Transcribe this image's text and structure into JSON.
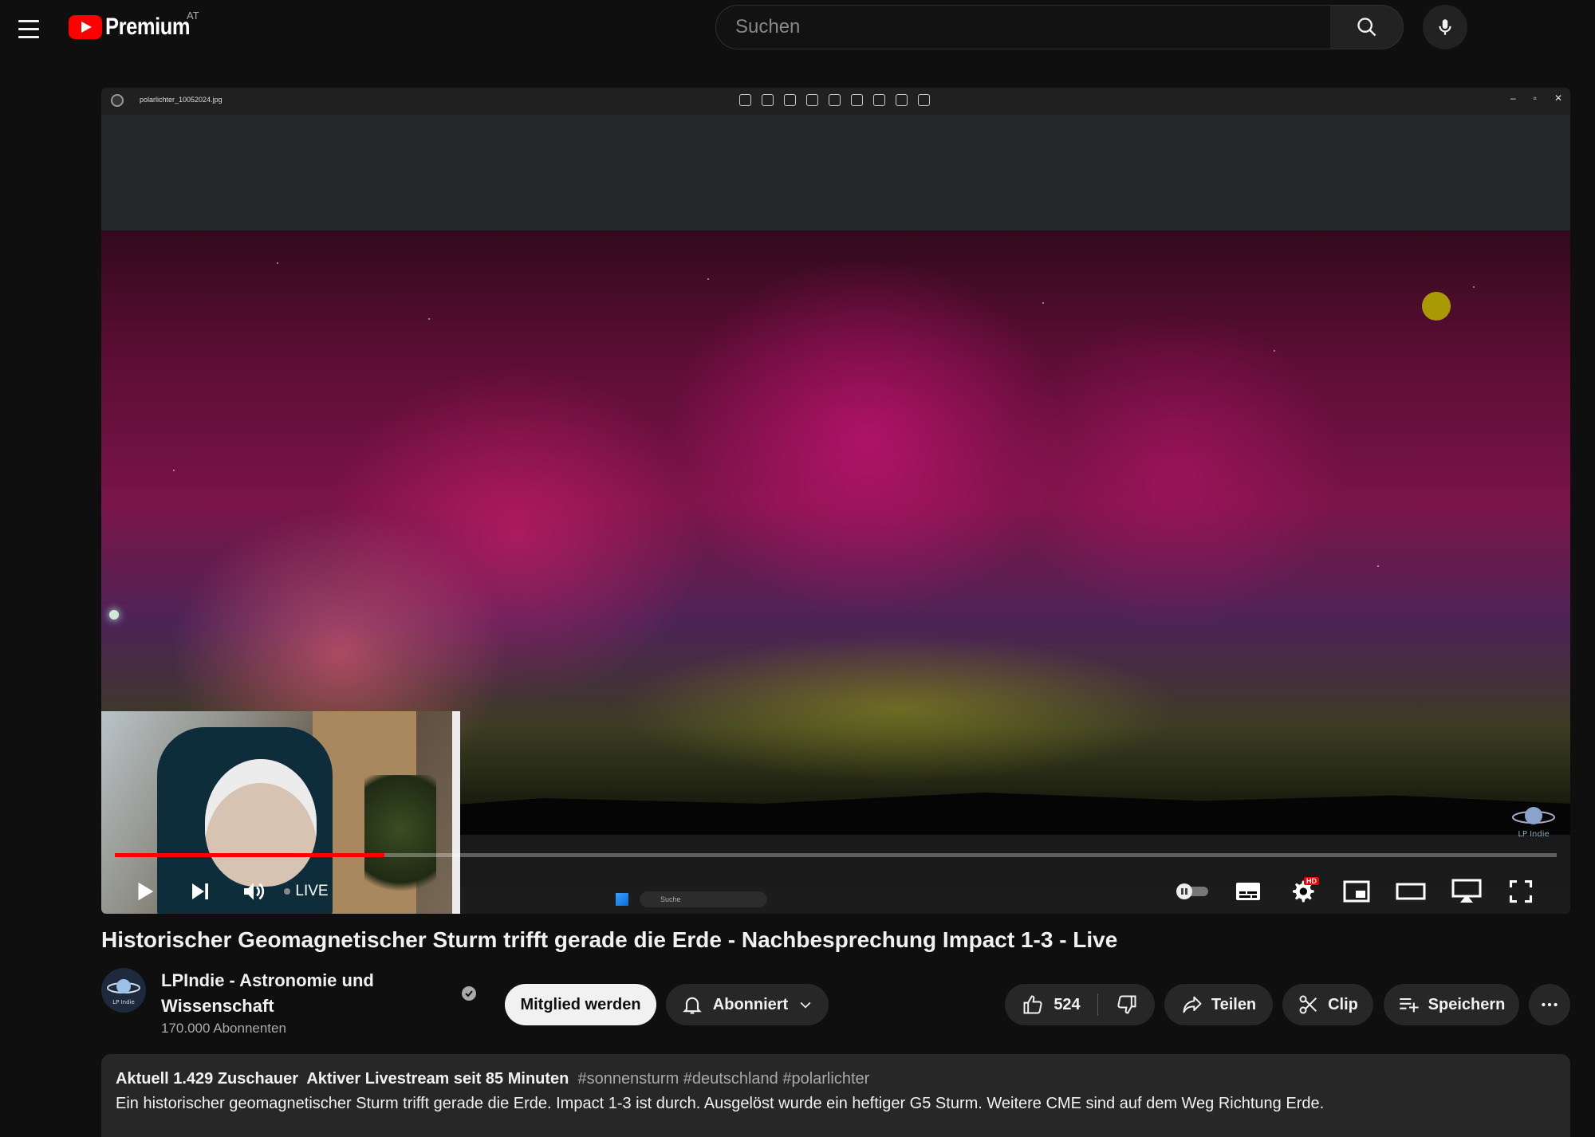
{
  "masthead": {
    "logo_text": "Premium",
    "country_code": "AT",
    "search_placeholder": "Suchen"
  },
  "player": {
    "window_file_name": "polarlichter_10052024.jpg",
    "live_label": "LIVE",
    "taskbar_search": "Suche",
    "progress_fraction": 0.187,
    "hd_badge": "HD",
    "watermark_text": "LP Indie"
  },
  "video": {
    "title": "Historischer Geomagnetischer Sturm trifft gerade die Erde - Nachbesprechung Impact 1-3 - Live"
  },
  "channel": {
    "name": "LPIndie - Astronomie und Wissenschaft",
    "subscribers": "170.000 Abonnenten",
    "avatar_text": "LP Indie"
  },
  "actions": {
    "join_label": "Mitglied werden",
    "subscribed_label": "Abonniert",
    "like_count": "524",
    "share_label": "Teilen",
    "clip_label": "Clip",
    "save_label": "Speichern"
  },
  "description": {
    "viewers": "Aktuell 1.429 Zuschauer",
    "stream_status": "Aktiver Livestream seit 85 Minuten",
    "hashtags": "#sonnensturm #deutschland #polarlichter",
    "text": "Ein historischer geomagnetischer Sturm trifft gerade die Erde. Impact 1-3 ist durch. Ausgelöst wurde ein heftiger G5 Sturm. Weitere CME sind auf dem Weg Richtung Erde."
  },
  "colors": {
    "background": "#0f0f0f",
    "brand_red": "#ff0000",
    "chip": "#272727",
    "text": "#f1f1f1",
    "secondary_text": "#aaaaaa"
  }
}
